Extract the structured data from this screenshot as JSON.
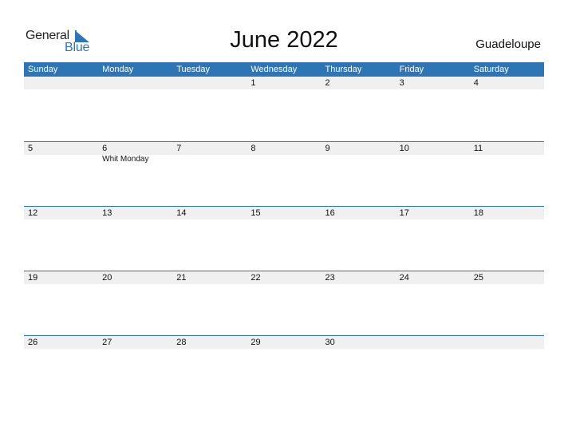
{
  "logo": {
    "word1": "General",
    "word2": "Blue",
    "accent": "#2e75b6"
  },
  "title": "June 2022",
  "region": "Guadeloupe",
  "weekdays": [
    "Sunday",
    "Monday",
    "Tuesday",
    "Wednesday",
    "Thursday",
    "Friday",
    "Saturday"
  ],
  "weeks": [
    [
      {
        "d": ""
      },
      {
        "d": ""
      },
      {
        "d": ""
      },
      {
        "d": "1"
      },
      {
        "d": "2"
      },
      {
        "d": "3"
      },
      {
        "d": "4"
      }
    ],
    [
      {
        "d": "5"
      },
      {
        "d": "6",
        "e": "Whit Monday"
      },
      {
        "d": "7"
      },
      {
        "d": "8"
      },
      {
        "d": "9"
      },
      {
        "d": "10"
      },
      {
        "d": "11"
      }
    ],
    [
      {
        "d": "12"
      },
      {
        "d": "13"
      },
      {
        "d": "14"
      },
      {
        "d": "15"
      },
      {
        "d": "16"
      },
      {
        "d": "17"
      },
      {
        "d": "18"
      }
    ],
    [
      {
        "d": "19"
      },
      {
        "d": "20"
      },
      {
        "d": "21"
      },
      {
        "d": "22"
      },
      {
        "d": "23"
      },
      {
        "d": "24"
      },
      {
        "d": "25"
      }
    ],
    [
      {
        "d": "26"
      },
      {
        "d": "27"
      },
      {
        "d": "28"
      },
      {
        "d": "29"
      },
      {
        "d": "30"
      },
      {
        "d": ""
      },
      {
        "d": ""
      }
    ]
  ]
}
